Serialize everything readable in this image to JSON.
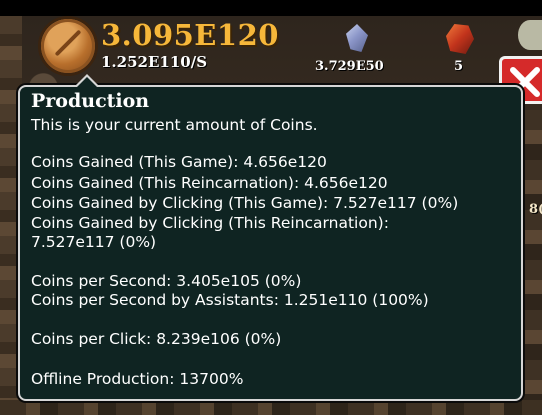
{
  "header": {
    "coins_amount": "3.095E120",
    "coins_per_second": "1.252E110/S",
    "gem_value": "3.729E50",
    "ruby_value": "5",
    "icons": {
      "coin": "coin-icon",
      "gem": "gem-icon",
      "ruby": "ruby-icon",
      "skull": "skull-icon",
      "close": "close-icon"
    }
  },
  "tooltip": {
    "title": "Production",
    "subtitle": "This is your current amount of Coins.",
    "lines": {
      "gained_game": "Coins Gained (This Game): 4.656e120",
      "gained_reincarnation": "Coins Gained (This Reincarnation): 4.656e120",
      "clicking_game": "Coins Gained by Clicking (This Game): 7.527e117 (0%)",
      "clicking_reincarnation": "Coins Gained by Clicking (This Reincarnation):",
      "clicking_reincarnation_value": "7.527e117 (0%)",
      "per_second": "Coins per Second: 3.405e105 (0%)",
      "per_second_assistants": "Coins per Second by Assistants: 1.251e110 (100%)",
      "per_click": "Coins per Click: 8.239e106 (0%)",
      "offline": "Offline Production: 13700%"
    }
  },
  "background": {
    "side_number": "8("
  },
  "colors": {
    "coin_gold": "#f6b73a",
    "tooltip_bg": "#0f2422",
    "tooltip_border": "#d6d6d6",
    "close_red": "#d52a2a"
  }
}
